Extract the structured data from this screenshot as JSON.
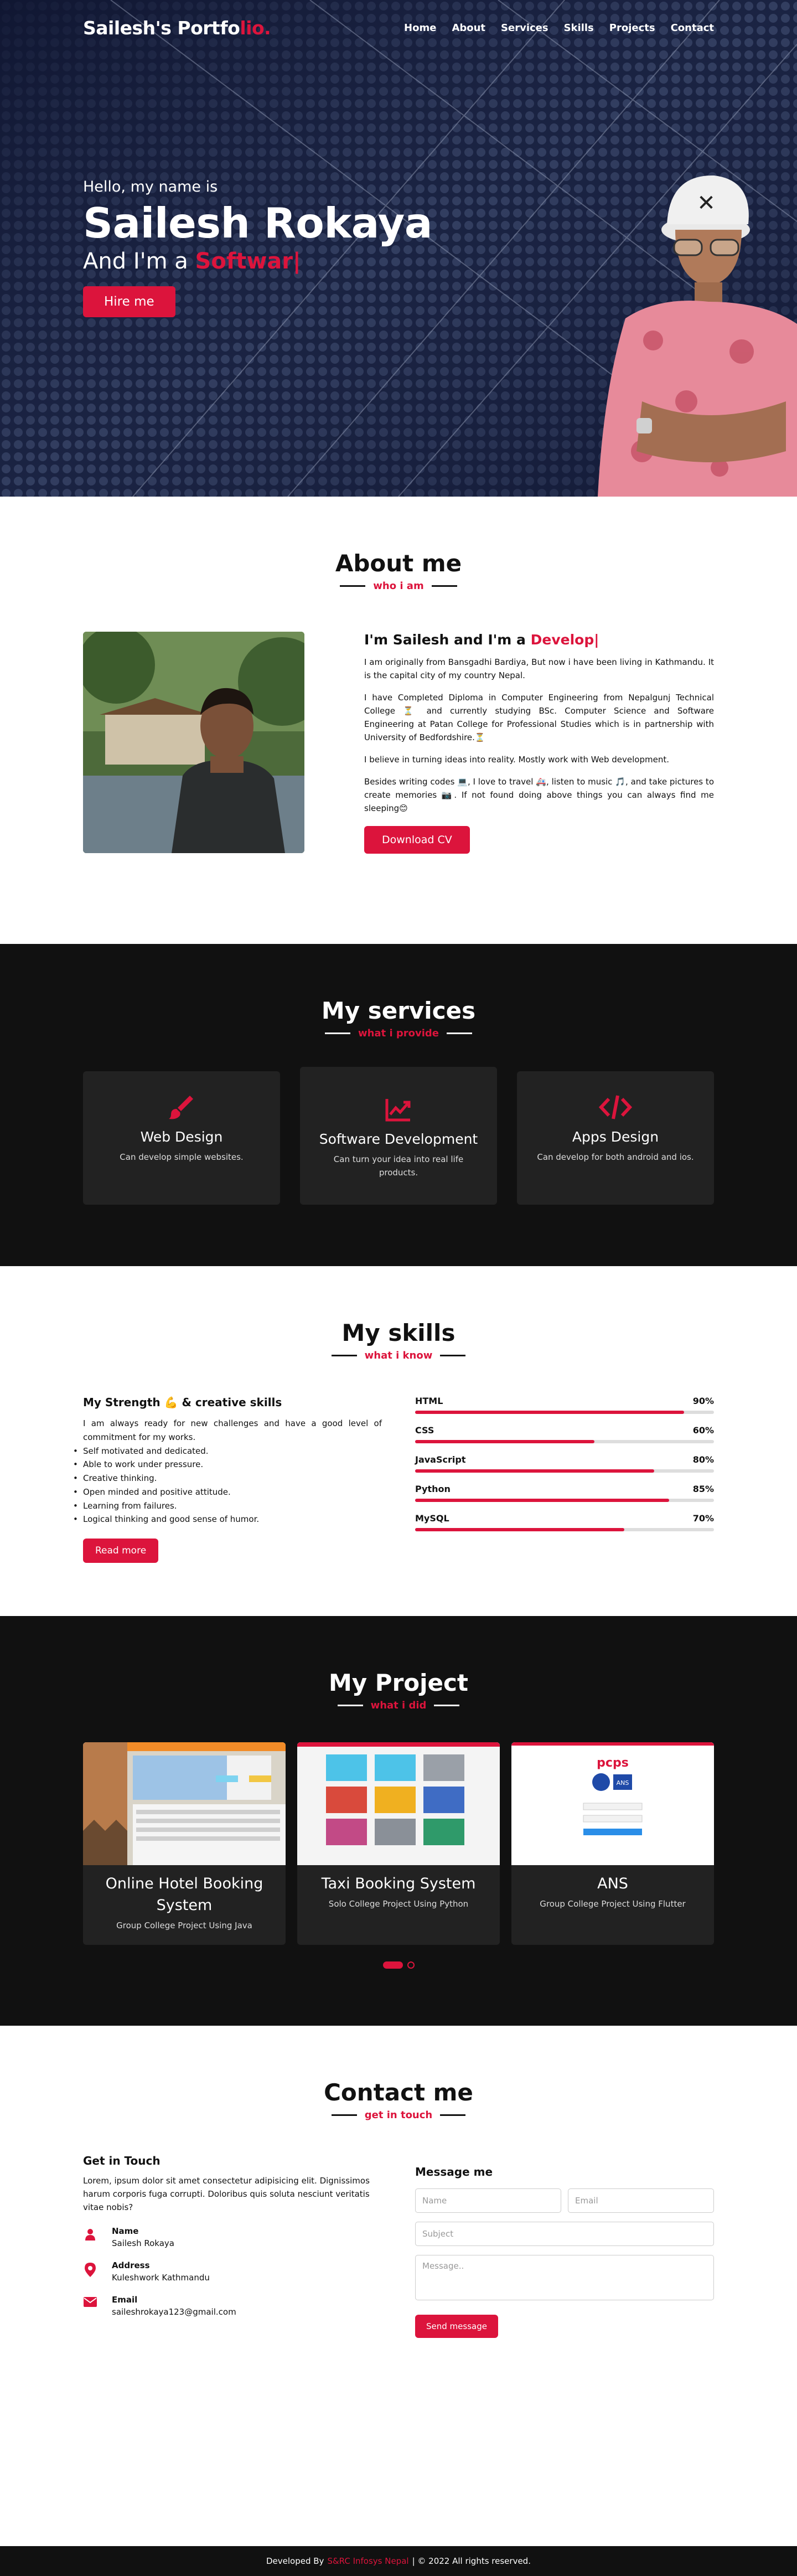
{
  "nav": {
    "logo_main": "Sailesh's Portfo",
    "logo_accent": "lio.",
    "menu": [
      "Home",
      "About",
      "Services",
      "Skills",
      "Projects",
      "Contact"
    ]
  },
  "hero": {
    "greeting": "Hello, my name is",
    "name": "Sailesh Rokaya",
    "role_prefix": "And I'm a",
    "role_typed": "Softwar|",
    "cta": "Hire me"
  },
  "about": {
    "title": "About me",
    "subtitle": "who i am",
    "headline_prefix": "I'm Sailesh and I'm a",
    "headline_typed": "Develop|",
    "paragraphs": [
      "I am originally from Bansgadhi Bardiya, But now i have been living in Kathmandu. It is the capital city of my country Nepal.",
      "I have Completed Diploma in Computer Engineering from Nepalgunj Technical College ⏳ and currently studying BSc. Computer Science and Software Engineering at Patan College for Professional Studies which is in partnership with University of Bedfordshire.⏳",
      "I believe in turning ideas into reality. Mostly work with Web development.",
      "Besides writing codes 💻, I love to travel 🚑, listen to music 🎵, and take pictures to create memories 📷. If not found doing above things you can always find me sleeping😊"
    ],
    "cta": "Download CV"
  },
  "services": {
    "title": "My services",
    "subtitle": "what i provide",
    "items": [
      {
        "icon": "paintbrush-icon",
        "title": "Web Design",
        "desc": "Can develop simple websites."
      },
      {
        "icon": "chart-line-icon",
        "title": "Software Development",
        "desc": "Can turn your idea into real life products."
      },
      {
        "icon": "code-icon",
        "title": "Apps Design",
        "desc": "Can develop for both android and ios."
      }
    ]
  },
  "skills": {
    "title": "My skills",
    "subtitle": "what i know",
    "strength_title": "My Strength 💪 & creative skills",
    "strength_text": "I am always ready for new challenges and have a good level of commitment for my works.",
    "strength_list": [
      "Self motivated and dedicated.",
      "Able to work under pressure.",
      "Creative thinking.",
      "Open minded and positive attitude.",
      "Learning from failures.",
      "Logical thinking and good sense of humor."
    ],
    "cta": "Read more",
    "bars": [
      {
        "name": "HTML",
        "percent_label": "90%",
        "value": 90
      },
      {
        "name": "CSS",
        "percent_label": "60%",
        "value": 60
      },
      {
        "name": "JavaScript",
        "percent_label": "80%",
        "value": 80
      },
      {
        "name": "Python",
        "percent_label": "85%",
        "value": 85
      },
      {
        "name": "MySQL",
        "percent_label": "70%",
        "value": 70
      }
    ]
  },
  "projects": {
    "title": "My Project",
    "subtitle": "what i did",
    "items": [
      {
        "title": "Online Hotel Booking System",
        "desc": "Group College Project Using Java"
      },
      {
        "title": "Taxi Booking System",
        "desc": "Solo College Project Using Python"
      },
      {
        "title": "ANS",
        "desc": "Group College Project Using Flutter"
      }
    ],
    "pcps_logo": "pcps",
    "ans_logo": "ANS"
  },
  "contact": {
    "title": "Contact me",
    "subtitle": "get in touch",
    "get_in_touch": "Get in Touch",
    "lorem": "Lorem, ipsum dolor sit amet consectetur adipisicing elit. Dignissimos harum corporis fuga corrupti. Doloribus quis soluta nesciunt veritatis vitae nobis?",
    "info": [
      {
        "icon": "user-icon",
        "title": "Name",
        "value": "Sailesh Rokaya"
      },
      {
        "icon": "map-marker-icon",
        "title": "Address",
        "value": "Kuleshwork Kathmandu"
      },
      {
        "icon": "envelope-icon",
        "title": "Email",
        "value": "saileshrokaya123@gmail.com"
      }
    ],
    "form_title": "Message me",
    "placeholders": {
      "name": "Name",
      "email": "Email",
      "subject": "Subject",
      "message": "Message.."
    },
    "send": "Send message"
  },
  "footer": {
    "prefix": "Developed By",
    "author": "S&RC Infosys Nepal",
    "suffix": "| © 2022 All rights reserved."
  },
  "colors": {
    "accent": "#dc143c",
    "dark": "#111111",
    "card": "#222222"
  }
}
